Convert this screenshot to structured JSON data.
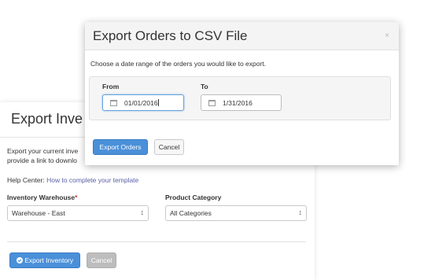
{
  "background_dialog": {
    "title": "Export Inve",
    "desc_line1": "Export your current inve",
    "desc_line2": "provide a link to downlo",
    "help_prefix": "Help Center:",
    "help_link": "How to complete your template",
    "warehouse": {
      "label": "Inventory Warehouse",
      "required_mark": "*",
      "value": "Warehouse - East"
    },
    "category": {
      "label": "Product Category",
      "value": "All Categories"
    },
    "export_button": "Export Inventory",
    "cancel_button": "Cancel"
  },
  "modal": {
    "title": "Export Orders to CSV File",
    "close_glyph": "×",
    "description": "Choose a date range of the orders you would like to export.",
    "from": {
      "label": "From",
      "value": "01/01/2016"
    },
    "to": {
      "label": "To",
      "value": "1/31/2016"
    },
    "export_button": "Export Orders",
    "cancel_button": "Cancel"
  },
  "icons": {
    "calendar": "calendar-icon",
    "check": "check-circle-icon",
    "select_arrows": "↕"
  },
  "colors": {
    "primary": "#4a90d9",
    "link": "#5b5fa8",
    "required": "#c0392b",
    "disabled": "#bdbdbd"
  }
}
